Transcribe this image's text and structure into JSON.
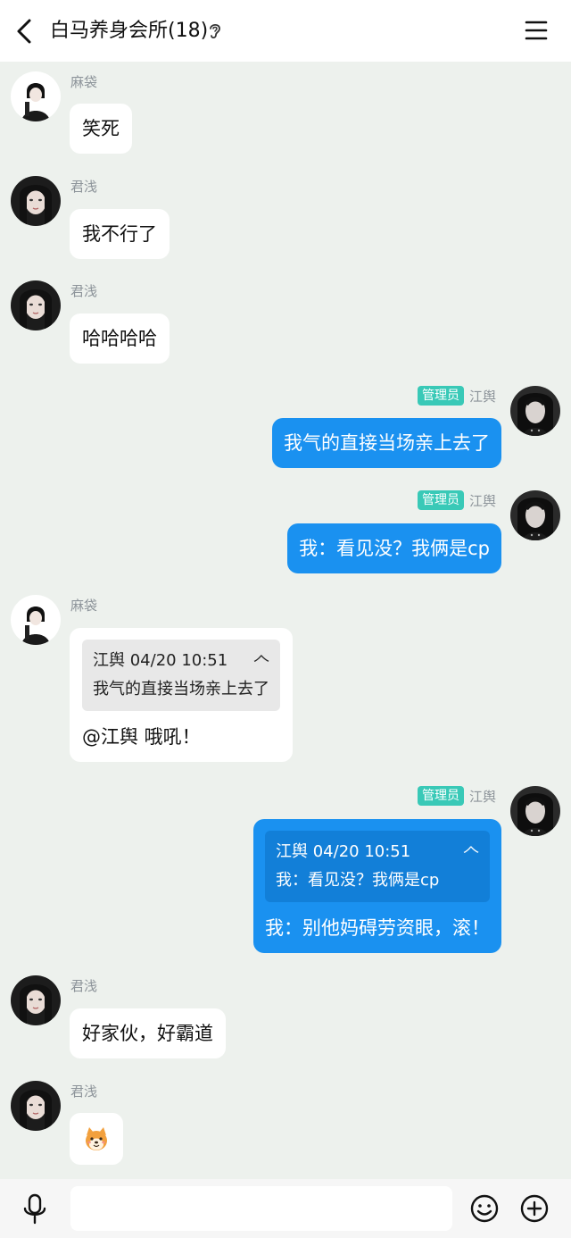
{
  "header": {
    "title": "白马养身会所(18)",
    "back_icon": "chevron-left-icon",
    "listen_icon": "ear-icon",
    "menu_icon": "hamburger-menu-icon"
  },
  "users": {
    "madai": "麻袋",
    "junqian": "君浅",
    "jiangyu": "江舆"
  },
  "admin_label": "管理员",
  "messages": [
    {
      "sender": "麻袋",
      "text": "笑死"
    },
    {
      "sender": "君浅",
      "text": "我不行了"
    },
    {
      "sender": "君浅",
      "text": "哈哈哈哈"
    },
    {
      "sender": "江舆",
      "badge": "管理员",
      "text": "我气的直接当场亲上去了"
    },
    {
      "sender": "江舆",
      "badge": "管理员",
      "text": "我：看见没？我俩是cp"
    },
    {
      "sender": "麻袋",
      "quote": {
        "header": "江舆 04/20 10:51",
        "text": "我气的直接当场亲上去了"
      },
      "text": "@江舆 哦吼！"
    },
    {
      "sender": "江舆",
      "badge": "管理员",
      "quote": {
        "header": "江舆 04/20 10:51",
        "text": "我：看见没？我俩是cp"
      },
      "text": "我：别他妈碍劳资眼，滚！"
    },
    {
      "sender": "君浅",
      "text": "好家伙，好霸道"
    },
    {
      "sender": "君浅",
      "sticker": "shiba-dog-emoji-icon"
    }
  ],
  "pin_glyph": "𠆢",
  "input": {
    "placeholder": "",
    "value": ""
  },
  "bottom_icons": {
    "mic": "microphone-icon",
    "emoji": "smiley-icon",
    "plus": "plus-circle-icon"
  },
  "colors": {
    "accent": "#1a91f0",
    "admin_badge": "#39c9b7",
    "background": "#edf1ed"
  }
}
